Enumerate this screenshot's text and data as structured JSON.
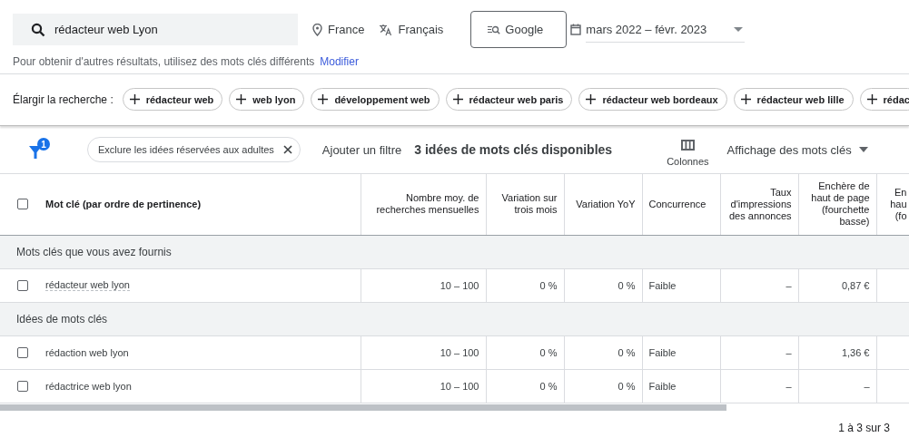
{
  "search": {
    "value": "rédacteur web Lyon"
  },
  "location": "France",
  "language": "Français",
  "network": "Google",
  "date_range": "mars 2022 – févr. 2023",
  "hint": {
    "text": "Pour obtenir d'autres résultats, utilisez des mots clés différents",
    "link": "Modifier"
  },
  "broaden": {
    "label": "Élargir la recherche :",
    "chips": [
      "rédacteur web",
      "web lyon",
      "développement web",
      "rédacteur web paris",
      "rédacteur web bordeaux",
      "rédacteur web lille",
      "rédac"
    ]
  },
  "toolbar": {
    "filter_count": "1",
    "filter_chip": "Exclure les idées réservées aux adultes",
    "add_filter": "Ajouter un filtre",
    "summary": "3 idées de mots clés disponibles",
    "columns_button": "Colonnes",
    "view_menu": "Affichage des mots clés"
  },
  "table": {
    "select_all_checked": false,
    "columns": [
      {
        "label": "Mot clé (par ordre de pertinence)",
        "kind": "text"
      },
      {
        "label": "Nombre moy. de recherches mensuelles",
        "kind": "number"
      },
      {
        "label": "Variation sur trois mois",
        "kind": "number"
      },
      {
        "label": "Variation YoY",
        "kind": "number"
      },
      {
        "label": "Concurrence",
        "kind": "text"
      },
      {
        "label": "Taux d'impressions des annonces",
        "kind": "number"
      },
      {
        "label": "Enchère de haut de page (fourchette basse)",
        "kind": "number"
      },
      {
        "label": "En\nhau\n(fo",
        "kind": "number"
      }
    ],
    "groups": [
      {
        "title": "Mots clés que vous avez fournis",
        "rows": [
          {
            "checked": false,
            "cells": [
              "rédacteur web lyon",
              "10 – 100",
              "0 %",
              "0 %",
              "Faible",
              "–",
              "0,87 €"
            ]
          }
        ]
      },
      {
        "title": "Idées de mots clés",
        "rows": [
          {
            "checked": false,
            "cells": [
              "rédaction web lyon",
              "10 – 100",
              "0 %",
              "0 %",
              "Faible",
              "–",
              "1,36 €"
            ]
          },
          {
            "checked": false,
            "cells": [
              "rédactrice web lyon",
              "10 – 100",
              "0 %",
              "0 %",
              "Faible",
              "–",
              "–"
            ]
          }
        ]
      }
    ]
  },
  "pagination": "1 à 3 sur 3"
}
